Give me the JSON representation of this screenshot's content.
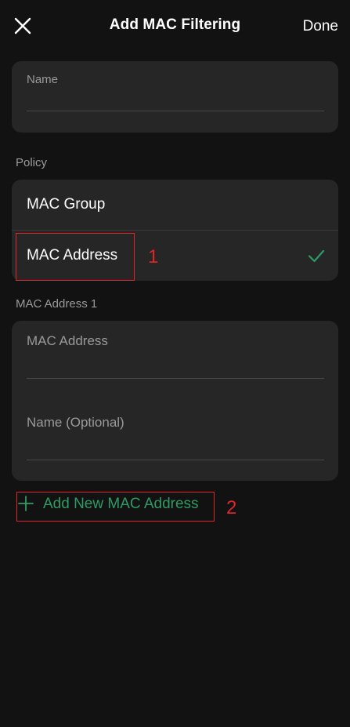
{
  "header": {
    "title": "Add MAC Filtering",
    "done_label": "Done"
  },
  "name_field": {
    "label": "Name",
    "value": ""
  },
  "policy": {
    "section_label": "Policy",
    "options": [
      {
        "label": "MAC Group",
        "selected": false
      },
      {
        "label": "MAC Address",
        "selected": true
      }
    ]
  },
  "mac_entry": {
    "section_label": "MAC Address 1",
    "mac_label": "MAC Address",
    "mac_value": "",
    "name_label": "Name (Optional)",
    "name_value": ""
  },
  "add_new_label": "Add New MAC Address",
  "annotations": {
    "one": "1",
    "two": "2"
  },
  "colors": {
    "background": "#121212",
    "card": "#262626",
    "accent_green": "#2f9a66",
    "annotation_red": "#e0242c",
    "muted_text": "#9a9a9a"
  },
  "icons": {
    "close": "close-icon",
    "check": "checkmark-icon",
    "plus": "plus-icon"
  }
}
